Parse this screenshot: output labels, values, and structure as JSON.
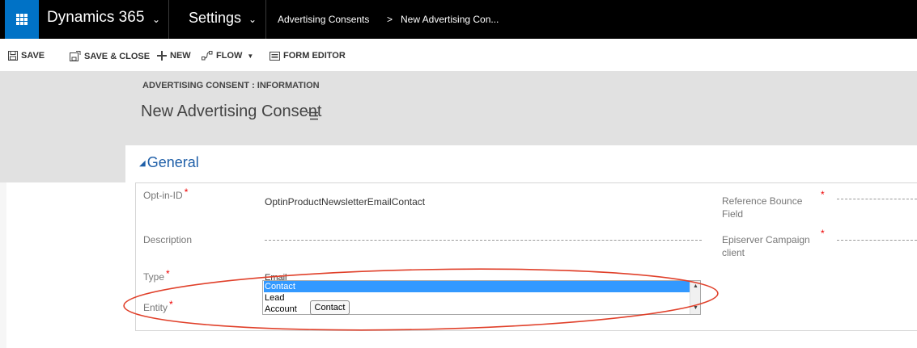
{
  "nav": {
    "app_name": "Dynamics 365",
    "area": "Settings",
    "breadcrumbs": [
      "Advertising Consents",
      "New Advertising Con..."
    ],
    "breadcrumb_separator": ">"
  },
  "commands": {
    "save": "SAVE",
    "save_close": "SAVE & CLOSE",
    "new": "NEW",
    "flow": "FLOW",
    "form_editor": "FORM EDITOR"
  },
  "header": {
    "entity_label": "ADVERTISING CONSENT : INFORMATION",
    "record_title": "New Advertising Consent"
  },
  "section": {
    "title": "General"
  },
  "fields": {
    "optin_id": {
      "label": "Opt-in-ID",
      "value": "OptinProductNewsletterEmailContact",
      "required_mark": "*"
    },
    "description": {
      "label": "Description",
      "value": ""
    },
    "type": {
      "label": "Type",
      "value_partial": "Email",
      "required_mark": "*"
    },
    "entity": {
      "label": "Entity",
      "required_mark": "*"
    },
    "reference_bounce": {
      "label_line1": "Reference Bounce",
      "label_line2": "Field",
      "required_mark": "*"
    },
    "episerver_client": {
      "label_line1": "Episerver Campaign",
      "label_line2": "client",
      "required_mark": "*"
    }
  },
  "entity_options": [
    "Contact",
    "Lead",
    "Account"
  ],
  "entity_selected": "Contact",
  "tooltip": "Contact",
  "colors": {
    "nav_bg": "#000000",
    "waffle_bg": "#0072c6",
    "header_bg": "#e1e1e1",
    "section_title": "#1f5fa8",
    "required": "#ee0000",
    "selection": "#3399ff",
    "annotation": "#e0402a"
  },
  "icons": {
    "app_launcher": "waffle-icon",
    "save": "floppy-icon",
    "save_close": "save-close-icon",
    "new": "plus-icon",
    "flow": "flow-icon",
    "form_editor": "form-editor-icon"
  }
}
